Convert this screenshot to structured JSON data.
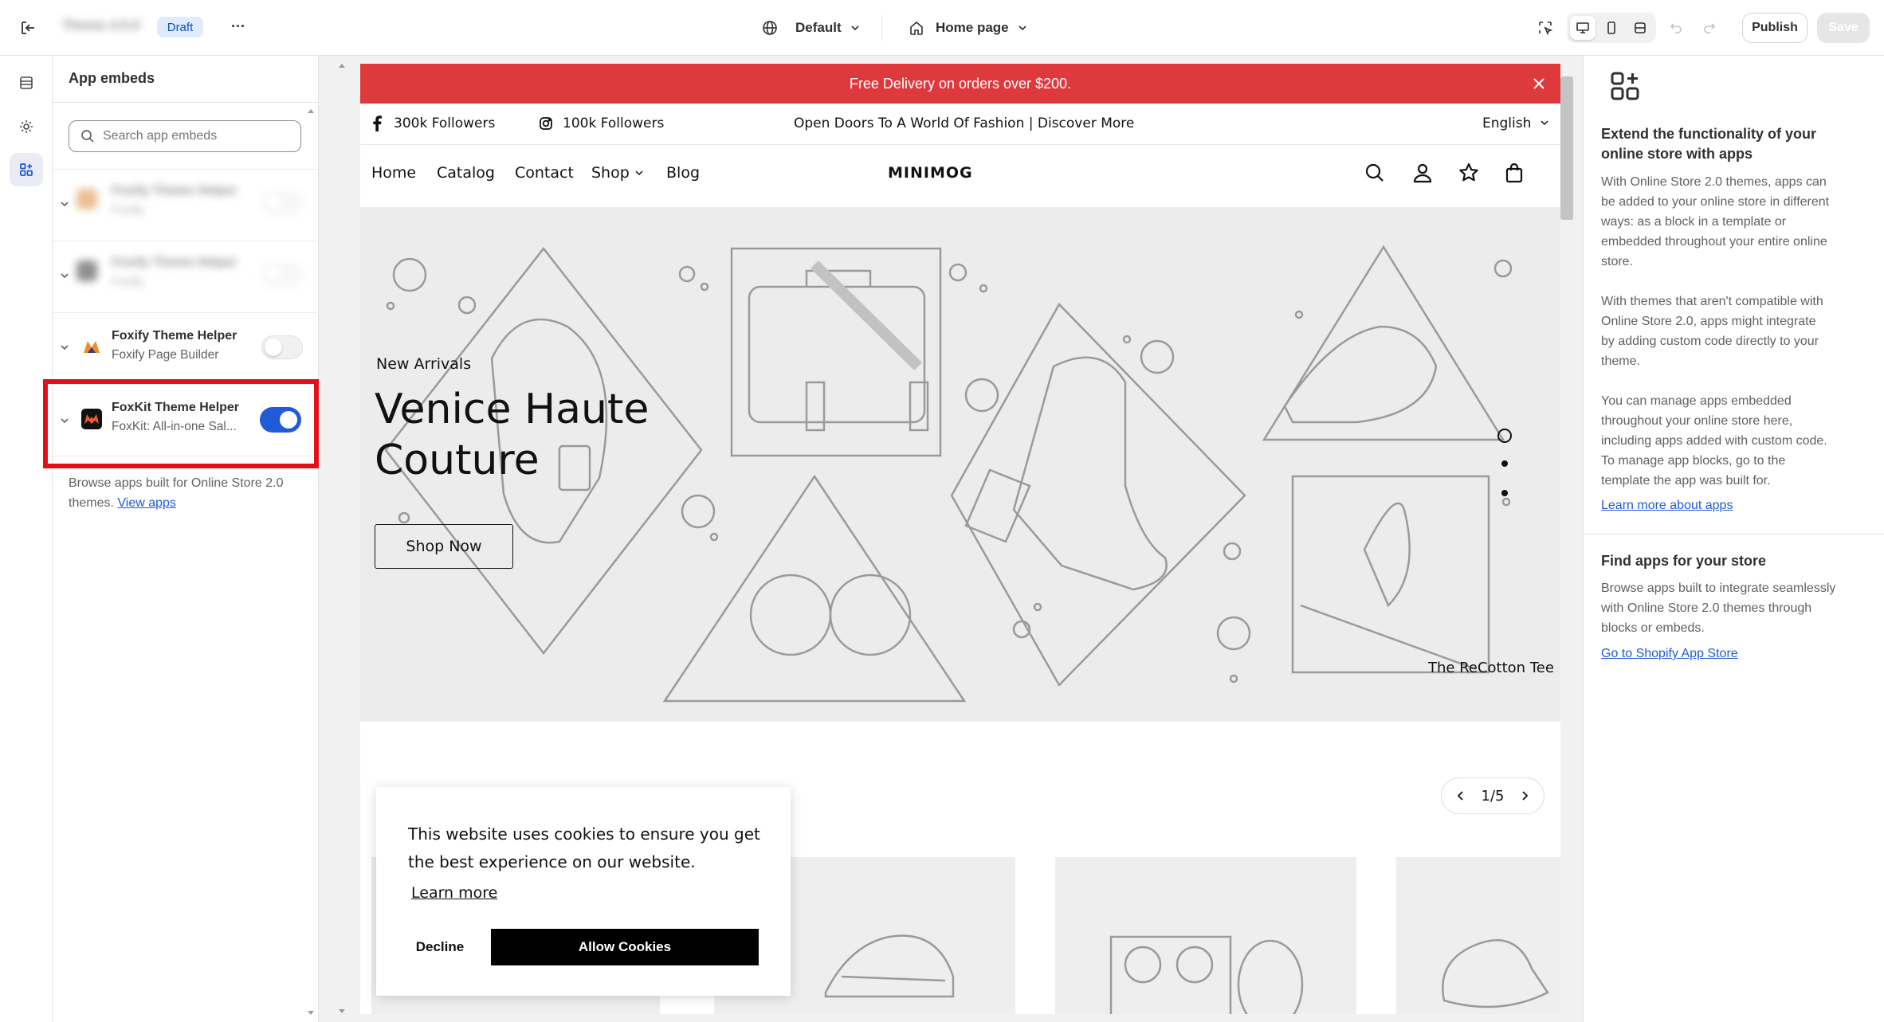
{
  "topbar": {
    "theme_name": "Theme 4.0.0",
    "draft_badge": "Draft",
    "more_label": "···",
    "theme_selector": "Default",
    "page_selector": "Home page",
    "publish_label": "Publish",
    "save_label": "Save"
  },
  "sidebar": {
    "title": "App embeds",
    "search_placeholder": "Search app embeds",
    "apps": [
      {
        "name": "Foxify Theme Helper",
        "subtitle": "Foxify Page Builder",
        "enabled": false
      },
      {
        "name": "FoxKit Theme Helper",
        "subtitle": "FoxKit: All-in-one Sal...",
        "enabled": true
      }
    ],
    "blurred_apps": [
      {
        "name": "Foxify Theme Helper",
        "subtitle": "Foxify"
      },
      {
        "name": "Foxify Theme Helper",
        "subtitle": "Foxify"
      }
    ],
    "browse_text": "Browse apps built for Online Store 2.0 themes.",
    "view_apps_link": "View apps"
  },
  "store": {
    "announcement": "Free Delivery on orders over $200.",
    "facebook_followers": "300k Followers",
    "instagram_followers": "100k Followers",
    "tagline": "Open Doors To A World Of Fashion | Discover More",
    "language": "English",
    "nav": [
      "Home",
      "Catalog",
      "Contact",
      "Shop",
      "Blog"
    ],
    "logo": "MINIMOG",
    "hero": {
      "eyebrow": "New Arrivals",
      "title_line1": "Venice Haute",
      "title_line2": "Couture",
      "cta": "Shop Now",
      "caption": "The ReCotton Tee"
    },
    "slider_counter": "1/5",
    "cookie": {
      "message": "This website uses cookies to ensure you get the best experience on our website.",
      "learn_more": "Learn more",
      "decline": "Decline",
      "allow": "Allow Cookies"
    }
  },
  "right_panel": {
    "heading": "Extend the functionality of your online store with apps",
    "para1": "With Online Store 2.0 themes, apps can be added to your online store in different ways: as a block in a template or embedded throughout your entire online store.",
    "para2": "With themes that aren't compatible with Online Store 2.0, apps might integrate by adding custom code directly to your theme.",
    "para3": "You can manage apps embedded throughout your online store here, including apps added with custom code. To manage app blocks, go to the template the app was built for.",
    "learn_link": "Learn more about apps",
    "find_heading": "Find apps for your store",
    "find_text": "Browse apps built to integrate seamlessly with Online Store 2.0 themes through blocks or embeds.",
    "store_link": "Go to Shopify App Store"
  },
  "colors": {
    "accent": "#1f5bd6",
    "announcement_bg": "#de3a3e",
    "highlight": "#e3101a"
  }
}
